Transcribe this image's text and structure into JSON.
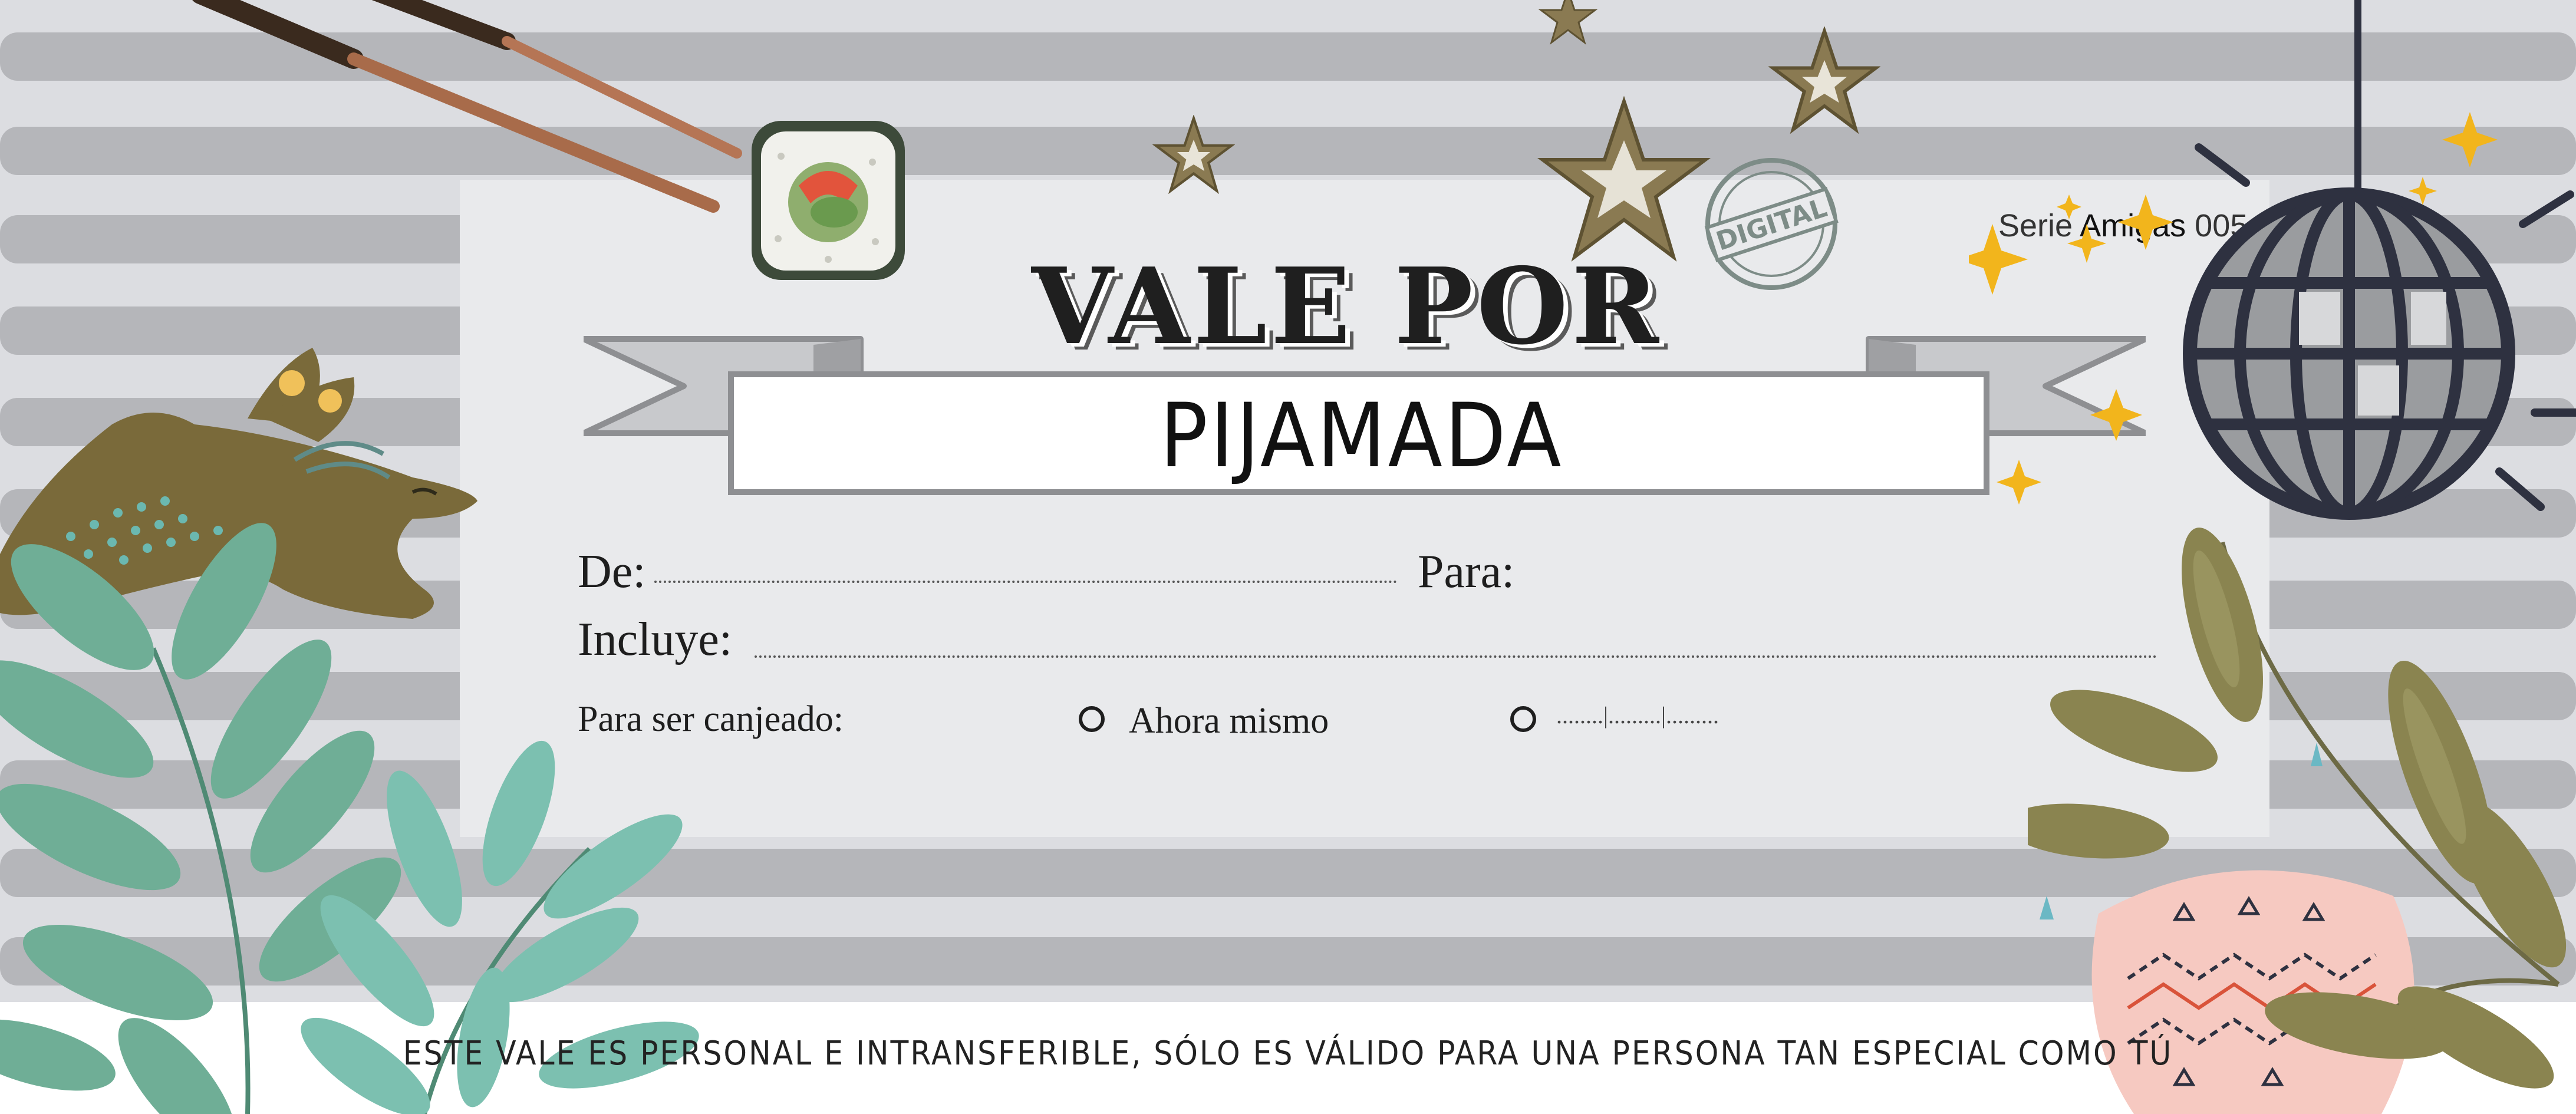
{
  "voucher": {
    "title": "VALE POR",
    "item": "PIJAMADA",
    "series_prefix": "Serie ",
    "series_name": "Amigas",
    "series_number": " 005",
    "stamp_text": "DIGITAL"
  },
  "form": {
    "from_label": "De:",
    "to_label": "Para:",
    "includes_label": "Incluye:",
    "redeem_label": "Para ser canjeado:",
    "option_now": "Ahora mismo",
    "option_date_blank": "........|.........|........."
  },
  "footer": {
    "text": "ESTE VALE ES PERSONAL E INTRANSFERIBLE, SÓLO ES VÁLIDO PARA UNA PERSONA TAN ESPECIAL COMO TÚ"
  },
  "colors": {
    "stripe": "#b5b6ba",
    "background": "#dcdde1",
    "card": "#e9eaec",
    "leaf_green": "#6fae96",
    "olive": "#8a8450",
    "hare": "#7a6a3a",
    "gold": "#f2b51c",
    "disco_ball": "#3a3f4e",
    "stamp": "#7d8c87"
  },
  "decorations": [
    "chopsticks-illustration",
    "sushi-roll-illustration",
    "star-icon",
    "digital-stamp",
    "hare-illustration",
    "disco-ball-illustration",
    "sparkle-icon",
    "leaf-branch-illustration",
    "pink-pillow-illustration"
  ]
}
